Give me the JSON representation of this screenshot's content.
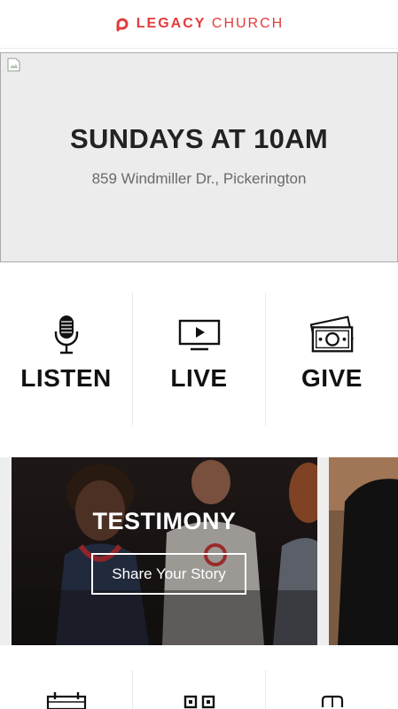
{
  "header": {
    "brand_bold": "LEGACY",
    "brand_light": "CHURCH",
    "brand_color": "#e23b3b",
    "logo_icon": "legacy-logo-mark"
  },
  "hero": {
    "title": "SUNDAYS AT 10AM",
    "address": "859 Windmiller Dr., Pickerington",
    "image_state": "broken-image-icon"
  },
  "actions": [
    {
      "label": "LISTEN",
      "icon": "microphone-icon"
    },
    {
      "label": "LIVE",
      "icon": "tv-play-icon"
    },
    {
      "label": "GIVE",
      "icon": "money-icon"
    }
  ],
  "carousel": {
    "cards": [
      {
        "title": "TESTIMONY",
        "button_label": "Share Your Story"
      }
    ]
  },
  "bottom_row": [
    {
      "icon": "calendar-icon"
    },
    {
      "icon": "qr-grid-icon"
    },
    {
      "icon": "gift-icon"
    }
  ]
}
